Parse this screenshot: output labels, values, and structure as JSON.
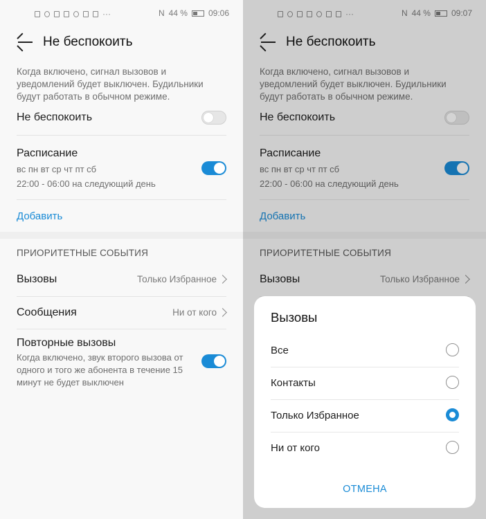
{
  "colors": {
    "accent": "#1a8bd6",
    "background": "#f8f8f8",
    "overlay": "rgba(0,0,0,0.17)"
  },
  "status": {
    "left": {
      "nfc": "N",
      "battery": "44 %",
      "time": "09:06"
    },
    "right": {
      "nfc": "N",
      "battery": "44 %",
      "time": "09:07"
    }
  },
  "screen": {
    "title": "Не беспокоить",
    "description": "Когда включено, сигнал вызовов и уведомлений будет выключен. Будильники будут работать в обычном режиме.",
    "dnd_label": "Не беспокоить",
    "schedule_label": "Расписание",
    "schedule_days": "вс пн вт ср чт пт сб",
    "schedule_time": "22:00 - 06:00 на следующий день",
    "add_label": "Добавить",
    "priority_title": "ПРИОРИТЕТНЫЕ СОБЫТИЯ",
    "calls_label": "Вызовы",
    "calls_value": "Только Избранное",
    "messages_label": "Сообщения",
    "messages_value": "Ни от кого",
    "repeat_label": "Повторные вызовы",
    "repeat_desc": "Когда включено, звук второго вызова от одного и того же абонента в течение 15 минут не будет выключен",
    "dnd_on": false,
    "schedule_on": true,
    "repeat_on": true
  },
  "dialog": {
    "title": "Вызовы",
    "options": [
      "Все",
      "Контакты",
      "Только Избранное",
      "Ни от кого"
    ],
    "selected": "Только Избранное",
    "cancel_label": "ОТМЕНА"
  }
}
